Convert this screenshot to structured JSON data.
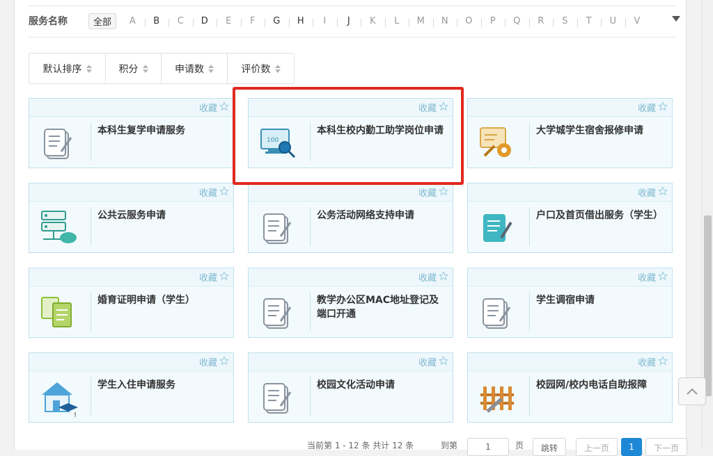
{
  "filter": {
    "label": "服务名称",
    "all_label": "全部",
    "letters": [
      "A",
      "B",
      "C",
      "D",
      "E",
      "F",
      "G",
      "H",
      "I",
      "J",
      "K",
      "L",
      "M",
      "N",
      "O",
      "P",
      "Q",
      "R",
      "S",
      "T",
      "U",
      "V"
    ],
    "active_letters": [
      "B",
      "D",
      "G",
      "H",
      "J"
    ]
  },
  "sort": {
    "buttons": [
      "默认排序",
      "积分",
      "申请数",
      "评价数"
    ]
  },
  "cards": [
    {
      "title": "本科生复学申请服务",
      "fav": "收藏",
      "icon": "document-pen-icon"
    },
    {
      "title": "本科生校内勤工助学岗位申请",
      "fav": "收藏",
      "icon": "monitor-magnifier-icon"
    },
    {
      "title": "大学城学生宿舍报修申请",
      "fav": "收藏",
      "icon": "wrench-gear-icon"
    },
    {
      "title": "公共云服务申请",
      "fav": "收藏",
      "icon": "server-cloud-icon"
    },
    {
      "title": "公务活动网络支持申请",
      "fav": "收藏",
      "icon": "document-pen-icon"
    },
    {
      "title": "户口及首页借出服务（学生）",
      "fav": "收藏",
      "icon": "teal-document-pen-icon"
    },
    {
      "title": "婚育证明申请（学生）",
      "fav": "收藏",
      "icon": "certificate-docs-icon"
    },
    {
      "title": "教学办公区MAC地址登记及端口开通",
      "fav": "收藏",
      "icon": "document-pen-icon"
    },
    {
      "title": "学生调宿申请",
      "fav": "收藏",
      "icon": "document-pen-icon"
    },
    {
      "title": "学生入住申请服务",
      "fav": "收藏",
      "icon": "house-graduation-icon"
    },
    {
      "title": "校园文化活动申请",
      "fav": "收藏",
      "icon": "document-pen-icon"
    },
    {
      "title": "校园网/校内电话自助报障",
      "fav": "收藏",
      "icon": "fence-wrench-icon"
    }
  ],
  "pagination": {
    "summary": "当前第 1 - 12 条 共计 12 条",
    "goto_label": "到第",
    "page_input_value": "1",
    "page_unit": "页",
    "jump_label": "跳转",
    "prev_label": "上一页",
    "current_page": "1",
    "next_label": "下一页"
  },
  "colors": {
    "card_border": "#bfe0ec",
    "card_bg": "#f2fafd",
    "highlight": "#e0281f",
    "page_active": "#1e88d6"
  }
}
